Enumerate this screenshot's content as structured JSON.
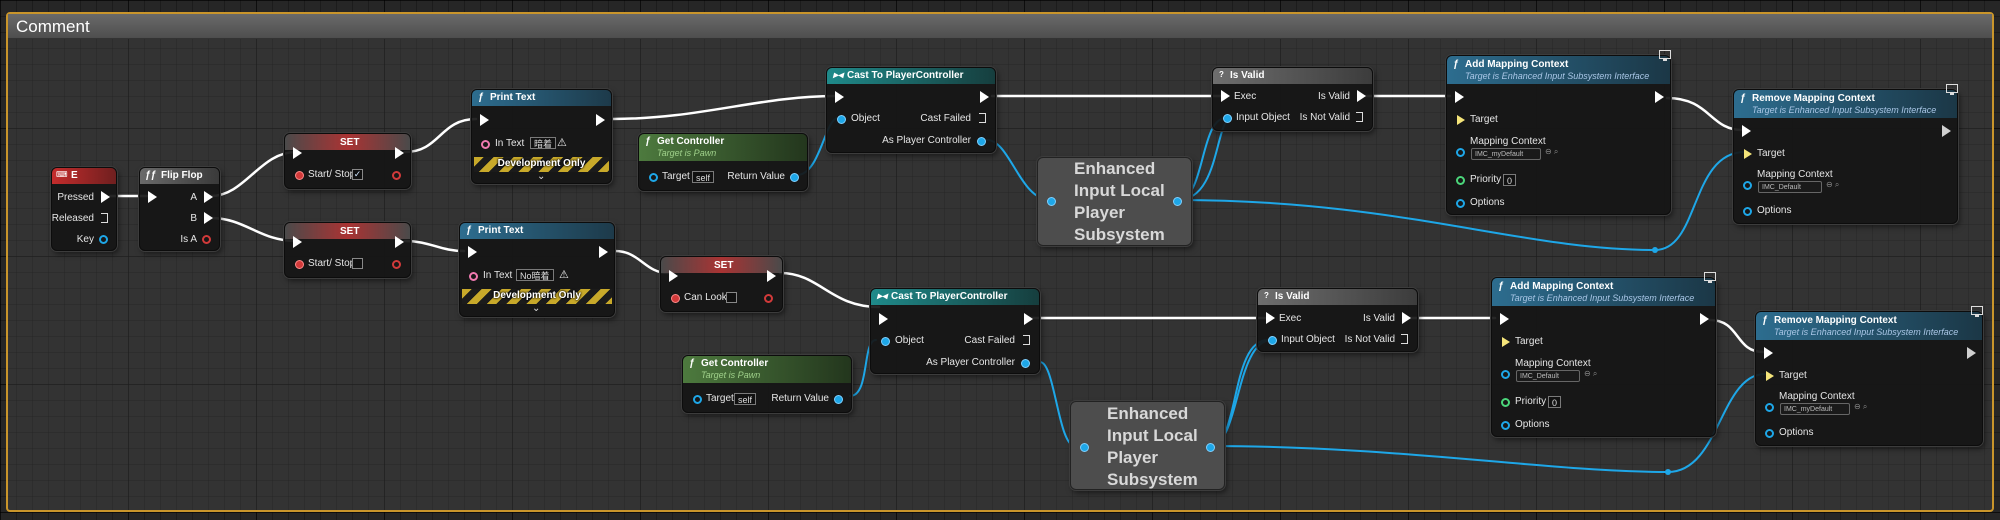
{
  "comment": {
    "title": "Comment"
  },
  "input_key": {
    "title": "E",
    "pressed": "Pressed",
    "released": "Released",
    "key": "Key"
  },
  "flip_flop": {
    "title": "Flip Flop",
    "a": "A",
    "b": "B",
    "is_a": "Is A"
  },
  "set_top": {
    "title": "SET",
    "var": "Start/ Stop",
    "checked": "✓"
  },
  "set_bottom": {
    "title": "SET",
    "var": "Start/ Stop"
  },
  "print_top": {
    "title": "Print Text",
    "in_text_label": "In Text",
    "in_text_value": "暗着",
    "dev": "Development Only"
  },
  "print_bottom": {
    "title": "Print Text",
    "in_text_label": "In Text",
    "in_text_value": "No暗着",
    "dev": "Development Only"
  },
  "get_controller_top": {
    "title": "Get Controller",
    "subtitle": "Target is Pawn",
    "target": "Target",
    "self": "self",
    "return": "Return Value"
  },
  "get_controller_bottom": {
    "title": "Get Controller",
    "subtitle": "Target is Pawn",
    "target": "Target",
    "self": "self",
    "return": "Return Value"
  },
  "set_canlook": {
    "title": "SET",
    "var": "Can Look"
  },
  "cast_top": {
    "title": "Cast To PlayerController",
    "object": "Object",
    "cast_failed": "Cast Failed",
    "as_pc": "As Player Controller"
  },
  "cast_bottom": {
    "title": "Cast To PlayerController",
    "object": "Object",
    "cast_failed": "Cast Failed",
    "as_pc": "As Player Controller"
  },
  "eilps_top": {
    "l1": "Enhanced",
    "l2": "Input Local",
    "l3": "Player",
    "l4": "Subsystem"
  },
  "eilps_bottom": {
    "l1": "Enhanced",
    "l2": "Input Local",
    "l3": "Player",
    "l4": "Subsystem"
  },
  "isvalid_top": {
    "title": "Is Valid",
    "exec": "Exec",
    "is_valid": "Is Valid",
    "input_object": "Input Object",
    "is_not_valid": "Is Not Valid"
  },
  "isvalid_bottom": {
    "title": "Is Valid",
    "exec": "Exec",
    "is_valid": "Is Valid",
    "input_object": "Input Object",
    "is_not_valid": "Is Not Valid"
  },
  "add_top": {
    "title": "Add Mapping Context",
    "subtitle": "Target is Enhanced Input Subsystem Interface",
    "target": "Target",
    "mc": "Mapping Context",
    "mc_value": "IMC_myDefault",
    "priority": "Priority",
    "priority_value": "0",
    "options": "Options"
  },
  "add_bottom": {
    "title": "Add Mapping Context",
    "subtitle": "Target is Enhanced Input Subsystem Interface",
    "target": "Target",
    "mc": "Mapping Context",
    "mc_value": "IMC_Default",
    "priority": "Priority",
    "priority_value": "0",
    "options": "Options"
  },
  "remove_top": {
    "title": "Remove Mapping Context",
    "subtitle": "Target is Enhanced Input Subsystem Interface",
    "target": "Target",
    "mc": "Mapping Context",
    "mc_value": "IMC_Default",
    "options": "Options"
  },
  "remove_bottom": {
    "title": "Remove Mapping Context",
    "subtitle": "Target is Enhanced Input Subsystem Interface",
    "target": "Target",
    "mc": "Mapping Context",
    "mc_value": "IMC_myDefault",
    "options": "Options"
  },
  "colors": {
    "exec": "#ffffff",
    "object_pin": "#1ea7e8",
    "comment_border": "#c9952b",
    "event_header": "#b22a2a",
    "function_header": "#2d6d8f",
    "pure_header": "#4d7a3e"
  }
}
